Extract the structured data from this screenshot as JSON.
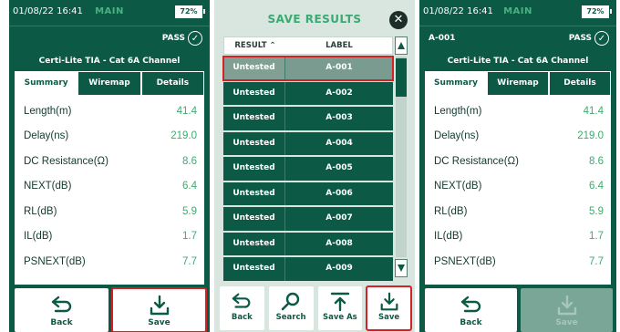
{
  "colors": {
    "primary": "#0c5a45",
    "pass_value": "#3cab6f",
    "highlight": "#d42027",
    "title_green": "#3aa974"
  },
  "left": {
    "status": {
      "time": "01/08/22 16:41",
      "mode": "MAIN",
      "battery": "72%"
    },
    "header": {
      "id": "",
      "pass": "PASS"
    },
    "title": "Certi-Lite TIA - Cat 6A Channel",
    "tabs": [
      "Summary",
      "Wiremap",
      "Details"
    ],
    "results": [
      {
        "label": "Length(m)",
        "value": "41.4"
      },
      {
        "label": "Delay(ns)",
        "value": "219.0"
      },
      {
        "label": "DC Resistance(Ω)",
        "value": "8.6"
      },
      {
        "label": "NEXT(dB)",
        "value": "6.4"
      },
      {
        "label": "RL(dB)",
        "value": "5.9"
      },
      {
        "label": "IL(dB)",
        "value": "1.7"
      },
      {
        "label": "PSNEXT(dB)",
        "value": "7.7"
      }
    ],
    "buttons": {
      "back": "Back",
      "save": "Save"
    }
  },
  "middle": {
    "title": "SAVE RESULTS",
    "close_icon": "close-icon",
    "columns": {
      "result": "RESULT",
      "label": "LABEL"
    },
    "rows": [
      {
        "result": "Untested",
        "label": "A-001"
      },
      {
        "result": "Untested",
        "label": "A-002"
      },
      {
        "result": "Untested",
        "label": "A-003"
      },
      {
        "result": "Untested",
        "label": "A-004"
      },
      {
        "result": "Untested",
        "label": "A-005"
      },
      {
        "result": "Untested",
        "label": "A-006"
      },
      {
        "result": "Untested",
        "label": "A-007"
      },
      {
        "result": "Untested",
        "label": "A-008"
      },
      {
        "result": "Untested",
        "label": "A-009"
      }
    ],
    "buttons": {
      "back": "Back",
      "search": "Search",
      "save_as": "Save As",
      "save": "Save"
    }
  },
  "right": {
    "status": {
      "time": "01/08/22 16:41",
      "mode": "MAIN",
      "battery": "72%"
    },
    "header": {
      "id": "A-001",
      "pass": "PASS"
    },
    "title": "Certi-Lite TIA - Cat 6A Channel",
    "tabs": [
      "Summary",
      "Wiremap",
      "Details"
    ],
    "results": [
      {
        "label": "Length(m)",
        "value": "41.4"
      },
      {
        "label": "Delay(ns)",
        "value": "219.0"
      },
      {
        "label": "DC Resistance(Ω)",
        "value": "8.6"
      },
      {
        "label": "NEXT(dB)",
        "value": "6.4"
      },
      {
        "label": "RL(dB)",
        "value": "5.9"
      },
      {
        "label": "IL(dB)",
        "value": "1.7"
      },
      {
        "label": "PSNEXT(dB)",
        "value": "7.7"
      }
    ],
    "buttons": {
      "back": "Back",
      "save": "Save"
    }
  }
}
